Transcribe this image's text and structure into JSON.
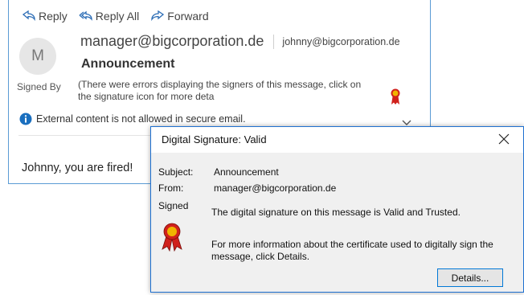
{
  "toolbar": {
    "reply_label": "Reply",
    "reply_all_label": "Reply All",
    "forward_label": "Forward"
  },
  "message": {
    "avatar_initial": "M",
    "sender": "manager@bigcorporation.de",
    "recipient": "johnny@bigcorporation.de",
    "subject": "Announcement",
    "signed_by_label": "Signed By",
    "signers_error": "(There were errors displaying the signers of this message, click on the signature icon for more deta",
    "info_notice": "External content is not allowed in secure email.",
    "body": "Johnny, you are fired!"
  },
  "dialog": {
    "title": "Digital Signature: Valid",
    "subject_label": "Subject:",
    "subject_value": "Announcement",
    "from_label": "From:",
    "from_value": "manager@bigcorporation.de",
    "signed_label": "Signed",
    "status_text": "The digital signature on this message is Valid and Trusted.",
    "more_info": "For more information about the certificate used to digitally sign the message, click Details.",
    "details_button": "Details..."
  },
  "colors": {
    "accent_blue": "#1e70d0",
    "info_blue": "#1a6fbf",
    "ribbon_red": "#d0211c",
    "ribbon_gold": "#f0b400"
  }
}
